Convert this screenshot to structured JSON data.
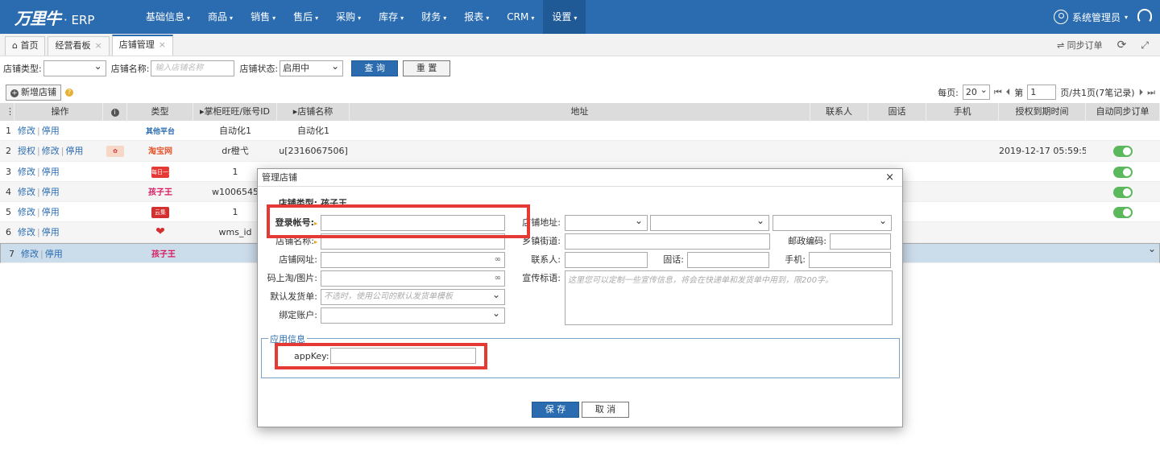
{
  "app": {
    "brand": "万里牛",
    "suffix": "· ERP"
  },
  "nav": [
    {
      "label": "基础信息"
    },
    {
      "label": "商品"
    },
    {
      "label": "销售"
    },
    {
      "label": "售后"
    },
    {
      "label": "采购"
    },
    {
      "label": "库存"
    },
    {
      "label": "财务"
    },
    {
      "label": "报表"
    },
    {
      "label": "CRM"
    },
    {
      "label": "设置"
    }
  ],
  "user": {
    "name": "系统管理员"
  },
  "tabs": [
    {
      "label": "首页"
    },
    {
      "label": "经营看板"
    },
    {
      "label": "店铺管理"
    }
  ],
  "tab_tools": {
    "sync_orders": "同步订单"
  },
  "search": {
    "shop_type_label": "店铺类型:",
    "shop_type_value": "",
    "shop_name_label": "店铺名称:",
    "shop_name_placeholder": "输入店铺名称",
    "shop_status_label": "店铺状态:",
    "shop_status_value": "启用中",
    "query_button": "查 询",
    "reset_button": "重 置"
  },
  "toolbar": {
    "add_shop": "新增店铺",
    "help": "?"
  },
  "pager": {
    "per_page_label": "每页:",
    "per_page": "20",
    "page_label": "第",
    "page": "1",
    "summary": "页/共1页(7笔记录)"
  },
  "table": {
    "headers": [
      "操作",
      "i",
      "类型",
      "▸掌柜旺旺/账号ID",
      "▸店铺名称",
      "地址",
      "联系人",
      "固话",
      "手机",
      "授权到期时间",
      "自动同步订单"
    ],
    "rows": [
      {
        "num": "1",
        "actions": [
          "修改",
          "停用"
        ],
        "platform": "其他平台",
        "account": "自动化1",
        "shop": "自动化1",
        "expire": "",
        "sync": false
      },
      {
        "num": "2",
        "actions": [
          "授权",
          "修改",
          "停用"
        ],
        "platform": "淘宝网",
        "account": "dr橙弋",
        "shop": "u[2316067506]",
        "expire": "2019-12-17 05:59:59",
        "sync": true
      },
      {
        "num": "3",
        "actions": [
          "修改",
          "停用"
        ],
        "platform": "每日一淘",
        "account": "1",
        "shop": "",
        "expire": "",
        "sync": true
      },
      {
        "num": "4",
        "actions": [
          "修改",
          "停用"
        ],
        "platform": "孩子王",
        "account": "w1006545",
        "shop": "",
        "expire": "",
        "sync": true
      },
      {
        "num": "5",
        "actions": [
          "修改",
          "停用"
        ],
        "platform": "云集",
        "account": "1",
        "shop": "",
        "expire": "",
        "sync": true
      },
      {
        "num": "6",
        "actions": [
          "修改",
          "停用"
        ],
        "platform": "",
        "account": "wms_id",
        "shop": "",
        "expire": "",
        "sync": false
      },
      {
        "num": "7",
        "actions": [
          "修改",
          "停用"
        ],
        "platform": "孩子王",
        "account": "",
        "shop": "",
        "expire": "",
        "sync": false
      }
    ]
  },
  "dialog": {
    "title": "管理店铺",
    "shop_type_label": "店铺类型:",
    "shop_type_value": "孩子王",
    "login_account_label": "登录帐号:",
    "shop_name_label": "店铺名称:",
    "shop_url_label": "店铺网址:",
    "qr_label": "码上淘/图片:",
    "default_shipping_label": "默认发货单:",
    "default_shipping_placeholder": "不选时，使用公司的默认发货单模板",
    "bind_account_label": "绑定账户:",
    "shop_address_label": "店铺地址:",
    "street_label": "乡镇街道:",
    "postcode_label": "邮政编码:",
    "contact_label": "联系人:",
    "phone_label": "固话:",
    "mobile_label": "手机:",
    "slogan_label": "宣传标语:",
    "slogan_placeholder": "这里您可以定制一些宣传信息，将会在快递单和发货单中用到，限200字。",
    "app_info_legend": "应用信息",
    "appkey_label": "appKey:",
    "save_button": "保 存",
    "cancel_button": "取 消"
  }
}
